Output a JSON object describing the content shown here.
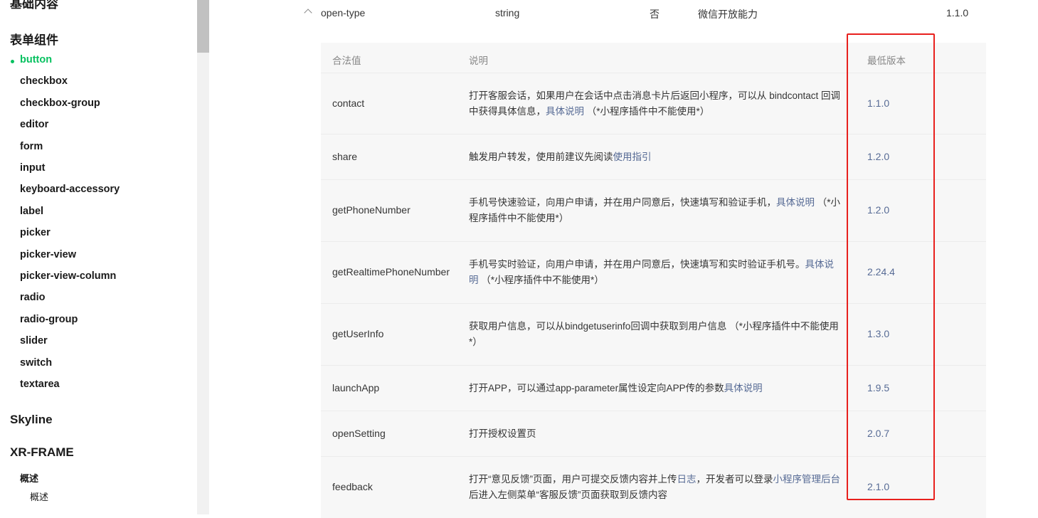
{
  "sidebar": {
    "cut_heading": "基础内容",
    "form_heading": "表单组件",
    "items": [
      {
        "label": "button",
        "active": true
      },
      {
        "label": "checkbox"
      },
      {
        "label": "checkbox-group"
      },
      {
        "label": "editor"
      },
      {
        "label": "form"
      },
      {
        "label": "input"
      },
      {
        "label": "keyboard-accessory"
      },
      {
        "label": "label"
      },
      {
        "label": "picker"
      },
      {
        "label": "picker-view"
      },
      {
        "label": "picker-view-column"
      },
      {
        "label": "radio"
      },
      {
        "label": "radio-group"
      },
      {
        "label": "slider"
      },
      {
        "label": "switch"
      },
      {
        "label": "textarea"
      }
    ],
    "skyline_heading": "Skyline",
    "xr_heading": "XR-FRAME",
    "xr_sub_heading": "概述",
    "xr_sub_item": "概述"
  },
  "prop_row": {
    "name": "open-type",
    "type": "string",
    "required": "否",
    "description": "微信开放能力",
    "version": "1.1.0"
  },
  "sub_table": {
    "headers": {
      "value": "合法值",
      "desc": "说明",
      "version": "最低版本"
    },
    "rows": [
      {
        "value": "contact",
        "desc_pre": "打开客服会话，如果用户在会话中点击消息卡片后返回小程序，可以从 bindcontact 回调中获得具体信息，",
        "desc_link": "具体说明",
        "desc_post": " （*小程序插件中不能使用*）",
        "version": "1.1.0"
      },
      {
        "value": "share",
        "desc_pre": "触发用户转发，使用前建议先阅读",
        "desc_link": "使用指引",
        "desc_post": "",
        "version": "1.2.0"
      },
      {
        "value": "getPhoneNumber",
        "desc_pre": "手机号快速验证，向用户申请，并在用户同意后，快速填写和验证手机，",
        "desc_link": "具体说明",
        "desc_post": " （*小程序插件中不能使用*）",
        "version": "1.2.0"
      },
      {
        "value": "getRealtimePhoneNumber",
        "desc_pre": "手机号实时验证，向用户申请，并在用户同意后，快速填写和实时验证手机号。",
        "desc_link": "具体说明",
        "desc_post": " （*小程序插件中不能使用*）",
        "version": "2.24.4"
      },
      {
        "value": "getUserInfo",
        "desc_pre": "获取用户信息，可以从bindgetuserinfo回调中获取到用户信息 （*小程序插件中不能使用*）",
        "desc_link": "",
        "desc_post": "",
        "version": "1.3.0"
      },
      {
        "value": "launchApp",
        "desc_pre": "打开APP，可以通过app-parameter属性设定向APP传的参数",
        "desc_link": "具体说明",
        "desc_post": "",
        "version": "1.9.5"
      },
      {
        "value": "openSetting",
        "desc_pre": "打开授权设置页",
        "desc_link": "",
        "desc_post": "",
        "version": "2.0.7"
      },
      {
        "value": "feedback",
        "desc_pre": "打开“意见反馈”页面，用户可提交反馈内容并上传",
        "desc_link": "日志",
        "desc_mid": "，开发者可以登录",
        "desc_link2": "小程序管理后台",
        "desc_post": "后进入左侧菜单“客服反馈”页面获取到反馈内容",
        "version": "2.1.0"
      }
    ]
  },
  "colors": {
    "accent": "#07c160",
    "link": "#576b95",
    "highlight": "#e8201d"
  }
}
